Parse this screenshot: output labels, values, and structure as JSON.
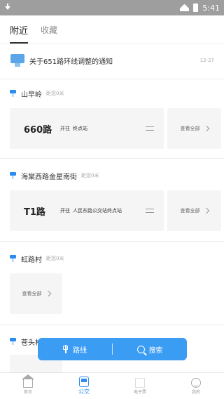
{
  "statusbar": {
    "time": "5:41"
  },
  "tabs": [
    {
      "label": "附近",
      "active": true
    },
    {
      "label": "收藏",
      "active": false
    }
  ],
  "notice": {
    "text": "关于651路环线调整的通知",
    "date": "12-27"
  },
  "stops": [
    {
      "name": "山早岭",
      "distance": "距您0米",
      "route": {
        "number": "660路",
        "direction": "开往",
        "destination": "终点站"
      },
      "view_all": "查看全部"
    },
    {
      "name": "海棠西路金星南街",
      "distance": "距您0米",
      "route": {
        "number": "T1路",
        "direction": "开往",
        "destination": "人民东路公交站终点站"
      },
      "view_all": "查看全部"
    },
    {
      "name": "虹路村",
      "distance": "距您0米",
      "view_all": "查看全部"
    },
    {
      "name": "苍头村"
    }
  ],
  "floatbar": {
    "route_label": "路线",
    "search_label": "搜索"
  },
  "bottomnav": [
    {
      "label": "首页",
      "icon": "home-icon",
      "active": false
    },
    {
      "label": "公交",
      "icon": "bus-icon",
      "active": true
    },
    {
      "label": "电子票",
      "icon": "ticket-icon",
      "active": false
    },
    {
      "label": "我的",
      "icon": "user-icon",
      "active": false
    }
  ],
  "colors": {
    "accent": "#2d8cf0",
    "floatbar": "#3a9cf3",
    "statusbar": "#9e9e9e",
    "card": "#f5f5f5"
  }
}
